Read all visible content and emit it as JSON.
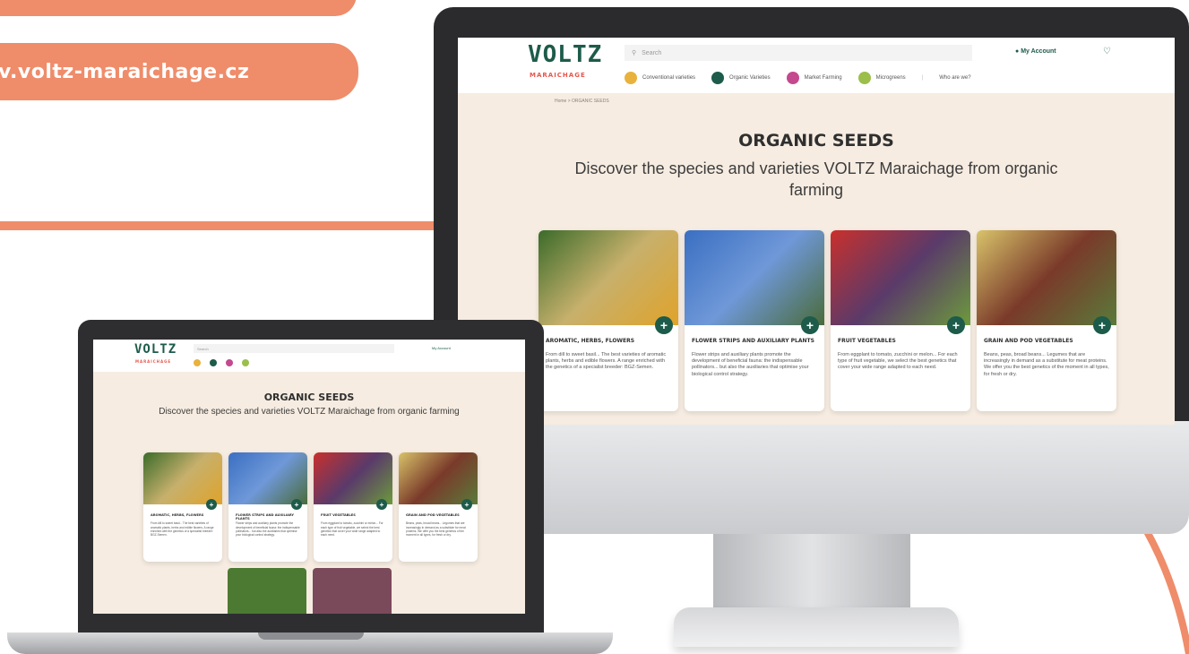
{
  "banner": {
    "website": "v.voltz-maraichage.cz"
  },
  "site": {
    "logo": "VOLTZ",
    "logo_sub": "MARAICHAGE",
    "search_placeholder": "Search",
    "account_label": "My Account",
    "nav": [
      {
        "label": "Conventional varieties",
        "color": "#e8b23c"
      },
      {
        "label": "Organic Varieties",
        "color": "#1d5b4a"
      },
      {
        "label": "Market Farming",
        "color": "#c4498f"
      },
      {
        "label": "Microgreens",
        "color": "#9bbf4a"
      }
    ],
    "nav_extra": "Who are we?",
    "breadcrumb": "Home  >  ORGANIC SEEDS",
    "page_title": "ORGANIC SEEDS",
    "page_subtitle": "Discover the species and varieties VOLTZ Maraichage from organic farming",
    "cards": [
      {
        "title": "AROMATIC, HERBS, FLOWERS",
        "desc": "From dill to sweet basil... The best varieties of aromatic plants, herbs and edible flowers. A range enriched with the genetics of a specialist breeder: BGZ-Semen.",
        "img": [
          "#3b6b2a",
          "#c7b06c",
          "#e0a32a"
        ]
      },
      {
        "title": "FLOWER STRIPS AND AUXILIARY PLANTS",
        "desc": "Flower strips and auxiliary plants promote the development of beneficial fauna: the indispensable pollinators... but also the auxiliaries that optimise your biological control strategy.",
        "img": [
          "#3a6fc2",
          "#6f98d8",
          "#4a6b3a"
        ]
      },
      {
        "title": "FRUIT VEGETABLES",
        "desc": "From eggplant to tomato, zucchini or melon... For each type of fruit vegetable, we select the best genetics that cover your wide range adapted to each need.",
        "img": [
          "#c9302c",
          "#5a3a6a",
          "#6c9a3c"
        ]
      },
      {
        "title": "GRAIN AND POD VEGETABLES",
        "desc": "Beans, peas, broad beans... Legumes that are increasingly in demand as a substitute for meat proteins. We offer you the best genetics of the moment in all types, for fresh or dry.",
        "img": [
          "#d8c36a",
          "#7a3a2a",
          "#5a7a3a"
        ]
      }
    ]
  }
}
